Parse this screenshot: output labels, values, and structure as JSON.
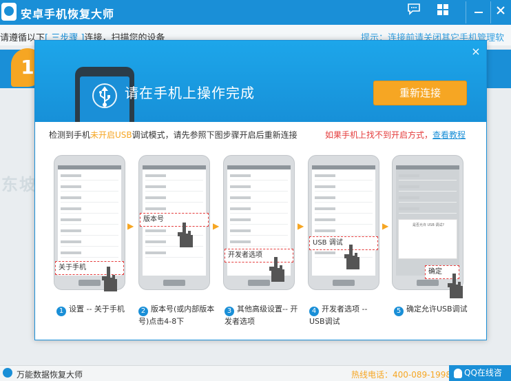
{
  "window": {
    "title": "安卓手机恢复大师",
    "icons": [
      "chat-icon",
      "grid-icon",
      "minimize-icon",
      "close-icon"
    ]
  },
  "background": {
    "instruction_prefix": "请遵循以下",
    "instruction_highlight": "[ 三步骤 ]",
    "instruction_suffix": "连接，扫描您的设备",
    "tip": "提示：连接前请关闭其它手机管理软",
    "step_badge": "1"
  },
  "modal": {
    "title": "请在手机上操作完成",
    "reconnect_label": "重新连接",
    "close_label": "×",
    "detect_prefix": "检测到手机",
    "detect_state": "未开启USB",
    "detect_suffix": "调试模式，请先参照下图步骤开启后重新连接",
    "help_text": "如果手机上找不到开启方式，",
    "help_link": "查看教程",
    "steps": [
      {
        "num": "1",
        "callout": "关于手机",
        "caption": "设置 -- 关于手机"
      },
      {
        "num": "2",
        "callout": "版本号",
        "caption": "版本号(或内部版本号)点击4-8下"
      },
      {
        "num": "3",
        "callout": "开发者选项",
        "caption": "其他高级设置-- 开发者选项"
      },
      {
        "num": "4",
        "callout": "USB 调试",
        "caption": "开发者选项 -- USB调试"
      },
      {
        "num": "5",
        "callout": "确定",
        "caption": "确定允许USB调试",
        "dialog_title": "是否允许 USB 调试?"
      }
    ]
  },
  "watermark": "东坡下载网",
  "statusbar": {
    "app_name": "万能数据恢复大师",
    "hotline": "热线电话：400-089-1998",
    "qq_label": "QQ在线咨"
  },
  "colors": {
    "primary": "#1a8fd7",
    "accent": "#f6a623",
    "alert": "#e43b3b"
  }
}
